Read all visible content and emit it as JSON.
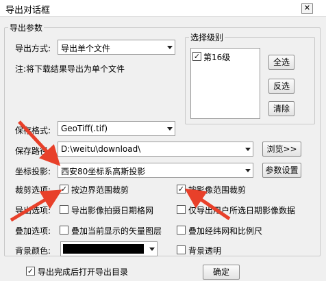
{
  "window": {
    "title": "导出对话框",
    "close_glyph": "✕"
  },
  "export_params": {
    "group_title": "导出参数",
    "mode_label": "导出方式:",
    "mode_value": "导出单个文件",
    "note": "注:将下载结果导出为单个文件"
  },
  "level": {
    "group_title": "选择级别",
    "items": [
      {
        "label": "第16级",
        "checked": true
      }
    ],
    "select_all": "全选",
    "invert": "反选",
    "clear": "清除"
  },
  "format": {
    "label": "保存格式:",
    "value": "GeoTiff(.tif)"
  },
  "path": {
    "label": "保存路径:",
    "value": "D:\\weitu\\download\\",
    "browse": "浏览>>"
  },
  "projection": {
    "label": "坐标投影:",
    "value": "西安80坐标系高斯投影",
    "settings": "参数设置"
  },
  "options": {
    "clip_label": "裁剪选项:",
    "clip_boundary": "按边界范围裁剪",
    "clip_image": "按影像范围裁剪",
    "export_label": "导出选项:",
    "export_date_grid": "导出影像拍摄日期格网",
    "export_user_date": "仅导出用户所选日期影像数据",
    "overlay_label": "叠加选项:",
    "overlay_vector": "叠加当前显示的矢量图层",
    "overlay_grid": "叠加经纬网和比例尺",
    "bg_label": "背景颜色:",
    "bg_color": "#000000",
    "bg_transparent": "背景透明"
  },
  "footer": {
    "open_dir": "导出完成后打开导出目录",
    "ok": "确定"
  },
  "colors": {
    "annotation_arrow": "#e8402a"
  }
}
